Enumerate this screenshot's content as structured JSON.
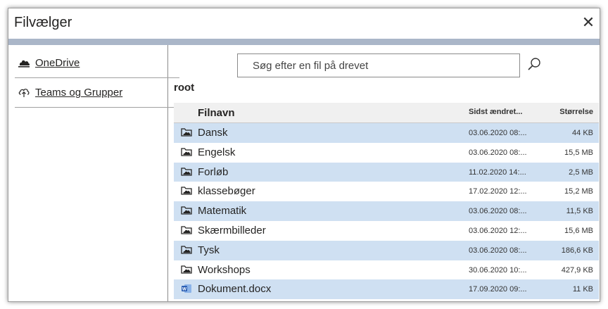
{
  "dialog": {
    "title": "Filvælger",
    "close_glyph": "✕",
    "accent_color": "#aab6c8"
  },
  "sidebar": {
    "items": [
      {
        "label": "OneDrive",
        "icon": "cloud-icon"
      },
      {
        "label": "Teams og Grupper",
        "icon": "cloud-upload-icon"
      }
    ]
  },
  "search": {
    "placeholder": "Søg efter en fil på drevet",
    "value": ""
  },
  "breadcrumb": "root",
  "table": {
    "headers": {
      "name": "Filnavn",
      "modified": "Sidst ændret...",
      "size": "Størrelse"
    },
    "row_highlight_color": "#cfe0f2",
    "rows": [
      {
        "name": "Dansk",
        "modified": "03.06.2020 08:...",
        "size": "44 KB",
        "type": "folder"
      },
      {
        "name": "Engelsk",
        "modified": "03.06.2020 08:...",
        "size": "15,5 MB",
        "type": "folder"
      },
      {
        "name": "Forløb",
        "modified": "11.02.2020 14:...",
        "size": "2,5 MB",
        "type": "folder"
      },
      {
        "name": "klassebøger",
        "modified": "17.02.2020 12:...",
        "size": "15,2 MB",
        "type": "folder"
      },
      {
        "name": "Matematik",
        "modified": "03.06.2020 08:...",
        "size": "11,5 KB",
        "type": "folder"
      },
      {
        "name": "Skærmbilleder",
        "modified": "03.06.2020 12:...",
        "size": "15,6 MB",
        "type": "folder"
      },
      {
        "name": "Tysk",
        "modified": "03.06.2020 08:...",
        "size": "186,6 KB",
        "type": "folder"
      },
      {
        "name": "Workshops",
        "modified": "30.06.2020 10:...",
        "size": "427,9 KB",
        "type": "folder"
      },
      {
        "name": "Dokument.docx",
        "modified": "17.09.2020 09:...",
        "size": "11 KB",
        "type": "word-document"
      }
    ]
  }
}
